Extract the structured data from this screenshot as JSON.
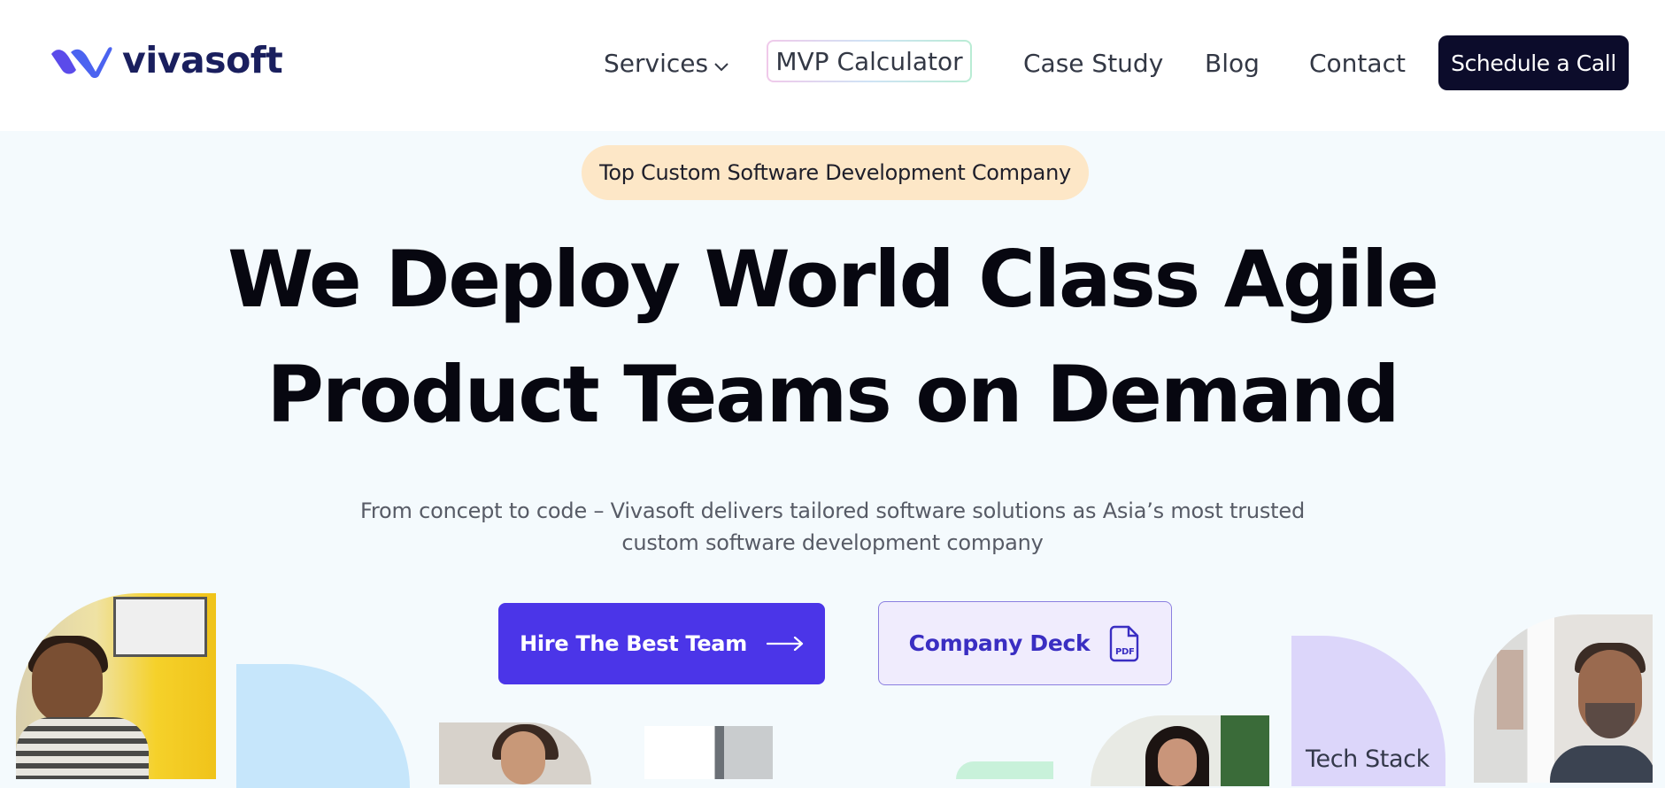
{
  "brand": {
    "name": "vivasoft",
    "logo_icon": "vivasoft-logo-mark",
    "color": "#1a1f5e",
    "mark_color": "#5b4bea"
  },
  "nav": {
    "services": "Services",
    "mvp": "MVP Calculator",
    "case_study": "Case Study",
    "blog": "Blog",
    "contact": "Contact",
    "cta": "Schedule a Call"
  },
  "hero": {
    "badge": "Top Custom Software Development Company",
    "headline_line1": "We Deploy World Class Agile",
    "headline_line2": "Product Teams on Demand",
    "subtext": "From concept to code – Vivasoft delivers tailored software solutions as Asia’s most trusted custom software development company",
    "primary_button": "Hire The Best Team",
    "secondary_button": "Company Deck"
  },
  "gallery": {
    "tech_label": "Tech Stack"
  },
  "colors": {
    "primary": "#4b35e8",
    "dark_cta": "#0c0c2b",
    "badge_bg": "#fde7c7",
    "hero_bg": "#f4fafd"
  }
}
